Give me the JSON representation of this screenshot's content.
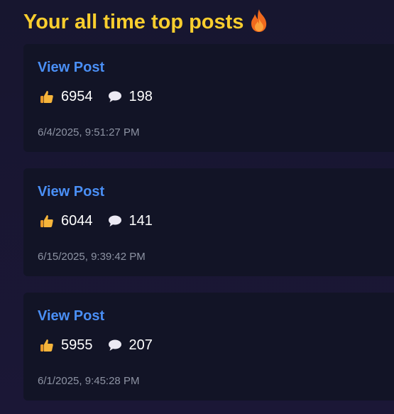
{
  "header": {
    "title": "Your all time top posts",
    "icon": "fire-icon",
    "color": "#f9ce2e"
  },
  "posts": [
    {
      "link_label": "View Post",
      "likes": "6954",
      "comments": "198",
      "date": "6/4/2025, 9:51:27 PM"
    },
    {
      "link_label": "View Post",
      "likes": "6044",
      "comments": "141",
      "date": "6/15/2025, 9:39:42 PM"
    },
    {
      "link_label": "View Post",
      "likes": "5955",
      "comments": "207",
      "date": "6/1/2025, 9:45:28 PM"
    }
  ],
  "icons": {
    "likes": "thumbs-up-icon",
    "comments": "speech-bubble-icon"
  },
  "colors": {
    "link": "#4a8ff5",
    "card": "#121426",
    "muted": "#8d93a3"
  }
}
